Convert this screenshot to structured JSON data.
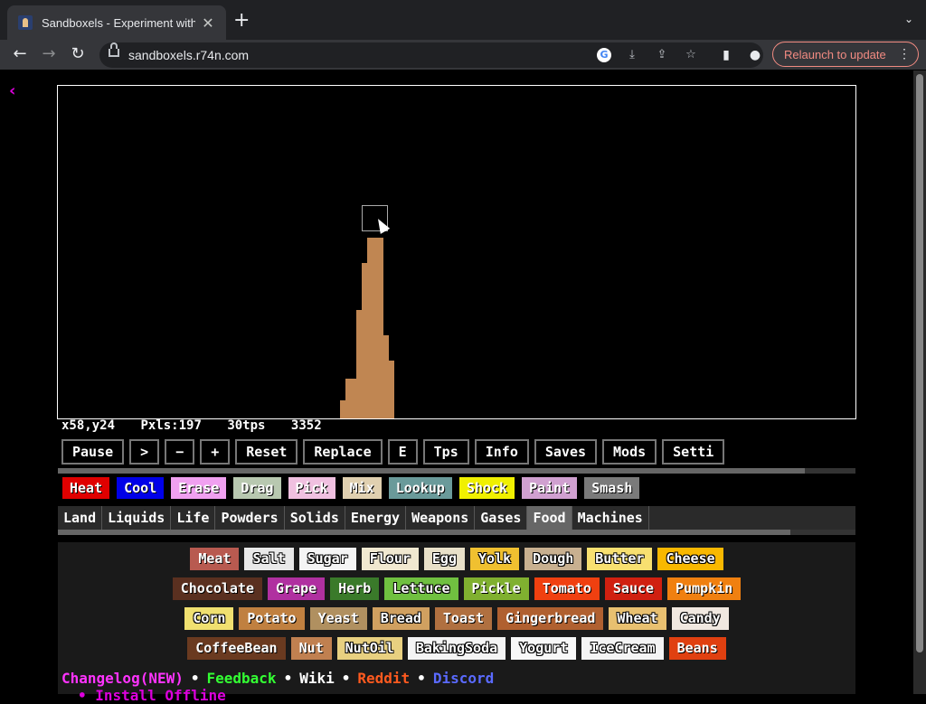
{
  "browser": {
    "tab_title": "Sandboxels - Experiment with P",
    "tab_close": "✕",
    "new_tab": "+",
    "tab_menu": "⌄",
    "url": "sandboxels.r74n.com",
    "relaunch_label": "Relaunch to update",
    "relaunch_menu": "⋮",
    "nav": {
      "back": "←",
      "forward": "→",
      "reload": "↻"
    },
    "omni_icons": {
      "google": "G",
      "install": "⤓",
      "share": "⇪",
      "bookmark": "☆"
    },
    "toolbar_icons": {
      "sidebar": "▮",
      "profile": "●"
    }
  },
  "game": {
    "back_icon": "‹",
    "stats": {
      "coords": "x58,y24",
      "pixels": "Pxls:197",
      "tps": "30tps",
      "ticks": "3352"
    },
    "controls": [
      "Pause",
      ">",
      "−",
      "+",
      "Reset",
      "Replace",
      "E",
      "Tps",
      "Info",
      "Saves",
      "Mods",
      "Setti"
    ],
    "tools": [
      {
        "label": "Heat",
        "bg": "#e00000"
      },
      {
        "label": "Cool",
        "bg": "#0000e8"
      },
      {
        "label": "Erase",
        "bg": "#f0a0f0"
      },
      {
        "label": "Drag",
        "bg": "#b8c8b0"
      },
      {
        "label": "Pick",
        "bg": "#f0c0e0"
      },
      {
        "label": "Mix",
        "bg": "#e0d0b0"
      },
      {
        "label": "Lookup",
        "bg": "#6a9a9a"
      },
      {
        "label": "Shock",
        "bg": "#f0f000"
      },
      {
        "label": "Paint",
        "bg": "#d0a0d0"
      },
      {
        "label": "Smash",
        "bg": "#7a7a7a"
      }
    ],
    "categories": [
      "Land",
      "Liquids",
      "Life",
      "Powders",
      "Solids",
      "Energy",
      "Weapons",
      "Gases",
      "Food",
      "Machines"
    ],
    "active_category": "Food",
    "elements": [
      [
        {
          "label": "Meat",
          "bg": "#b85a50"
        },
        {
          "label": "Salt",
          "bg": "#e8e8e8"
        },
        {
          "label": "Sugar",
          "bg": "#f4f4f4"
        },
        {
          "label": "Flour",
          "bg": "#f0e8d0"
        },
        {
          "label": "Egg",
          "bg": "#e8e0c8"
        },
        {
          "label": "Yolk",
          "bg": "#f0c030"
        },
        {
          "label": "Dough",
          "bg": "#c8b090"
        },
        {
          "label": "Butter",
          "bg": "#f8e070"
        },
        {
          "label": "Cheese",
          "bg": "#f8b800"
        }
      ],
      [
        {
          "label": "Chocolate",
          "bg": "#5a3020"
        },
        {
          "label": "Grape",
          "bg": "#b030a0"
        },
        {
          "label": "Herb",
          "bg": "#3a7a2a"
        },
        {
          "label": "Lettuce",
          "bg": "#70c040"
        },
        {
          "label": "Pickle",
          "bg": "#80b030"
        },
        {
          "label": "Tomato",
          "bg": "#f04010"
        },
        {
          "label": "Sauce",
          "bg": "#d02010"
        },
        {
          "label": "Pumpkin",
          "bg": "#f08010"
        }
      ],
      [
        {
          "label": "Corn",
          "bg": "#f0e070"
        },
        {
          "label": "Potato",
          "bg": "#c08040"
        },
        {
          "label": "Yeast",
          "bg": "#b09060"
        },
        {
          "label": "Bread",
          "bg": "#d0a060"
        },
        {
          "label": "Toast",
          "bg": "#b07040"
        },
        {
          "label": "Gingerbread",
          "bg": "#b06030"
        },
        {
          "label": "Wheat",
          "bg": "#e8c070"
        },
        {
          "label": "Candy",
          "bg": "#f0e8e0"
        }
      ],
      [
        {
          "label": "CoffeeBean",
          "bg": "#6a3a20"
        },
        {
          "label": "Nut",
          "bg": "#c08050"
        },
        {
          "label": "NutOil",
          "bg": "#e8d080"
        },
        {
          "label": "BakingSoda",
          "bg": "#f4f4f4"
        },
        {
          "label": "Yogurt",
          "bg": "#f8f8f8"
        },
        {
          "label": "IceCream",
          "bg": "#f4f4f4"
        },
        {
          "label": "Beans",
          "bg": "#e04010"
        }
      ]
    ],
    "footer": [
      {
        "label": "Changelog(NEW)",
        "color": "#ff33ff"
      },
      {
        "label": "Feedback",
        "color": "#33ff33"
      },
      {
        "label": "Wiki",
        "color": "#ffffff"
      },
      {
        "label": "Reddit",
        "color": "#ff5a1f"
      },
      {
        "label": "Discord",
        "color": "#5a6aff"
      }
    ],
    "footer_separator": "•",
    "footer2": "Install Offline"
  }
}
